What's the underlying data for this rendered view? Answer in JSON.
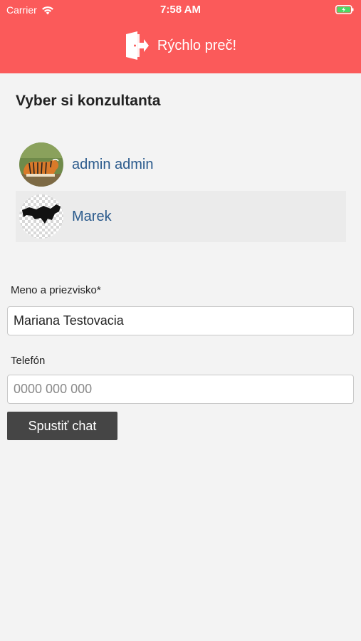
{
  "status_bar": {
    "carrier": "Carrier",
    "time": "7:58 AM",
    "wifi_icon": "wifi-icon",
    "battery_icon": "battery-charging-icon"
  },
  "header": {
    "button_label": "Rýchlo preč!",
    "icon": "exit-door-icon",
    "background": "#fb5a5a"
  },
  "consultants": {
    "title": "Vyber si konzultanta",
    "items": [
      {
        "name": "admin admin",
        "avatar": "tiger-avatar"
      },
      {
        "name": "Marek",
        "avatar": "fox-silhouette-avatar"
      }
    ]
  },
  "form": {
    "name_label": "Meno a priezvisko*",
    "name_value": "Mariana Testovacia",
    "phone_label": "Telefón",
    "phone_placeholder": "0000 000 000",
    "submit_label": "Spustiť chat"
  }
}
